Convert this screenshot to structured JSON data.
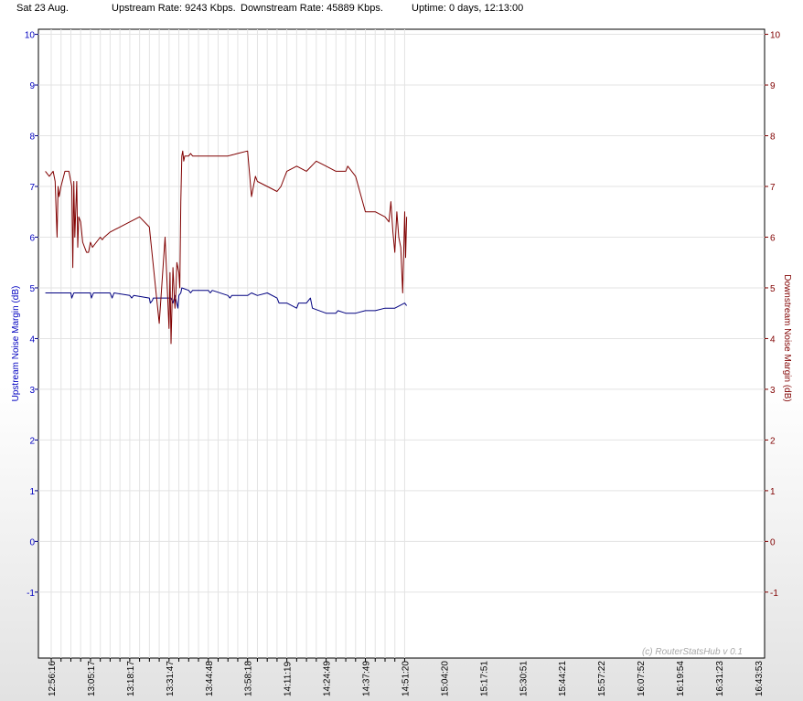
{
  "header": {
    "date": "Sat 23 Aug.",
    "upstream_rate": "Upstream Rate: 9243 Kbps.",
    "downstream_rate": "Downstream Rate: 45889 Kbps.",
    "uptime": "Uptime: 0 days, 12:13:00"
  },
  "watermark": "(c) RouterStatsHub v 0.1",
  "colors": {
    "upstream": "#000080",
    "downstream": "#800000",
    "left_axis": "#0000c0",
    "right_axis": "#800000"
  },
  "chart_data": {
    "type": "line",
    "ylabel_left": "Upstream Noise Margin (dB)",
    "ylabel_right": "Downstream Noise Margin (dB)",
    "ylim": [
      -2.3,
      10.1
    ],
    "yticks": [
      10,
      9,
      8,
      7,
      6,
      5,
      4,
      3,
      2,
      1,
      0,
      -1
    ],
    "x_tick_labels": [
      "12:56:16",
      "13:05:17",
      "13:18:17",
      "13:31:47",
      "13:44:48",
      "13:58:18",
      "14:11:19",
      "14:24:49",
      "14:37:49",
      "14:51:20",
      "15:04:20",
      "15:17:51",
      "15:30:51",
      "15:44:21",
      "15:57:22",
      "16:07:52",
      "16:19:54",
      "16:31:23",
      "16:43:53"
    ],
    "x_tick_pos": [
      0,
      0.5,
      1,
      1.5,
      2,
      2.5,
      3,
      3.5,
      4,
      4.5,
      5,
      5.5,
      6,
      6.5,
      7,
      7.5,
      8,
      8.5,
      9,
      9.5,
      10,
      10.5,
      11,
      11.5,
      12,
      12.5,
      13,
      13.5,
      14,
      14.5,
      15,
      15.5,
      16,
      16.5,
      17,
      17.5,
      18
    ],
    "grid": true,
    "series": [
      {
        "name": "Upstream Noise Margin (dB)",
        "axis": "left",
        "x": [
          -0.3,
          1,
          1.05,
          1.15,
          1.2,
          2,
          2.05,
          2.15,
          2.2,
          3,
          3.1,
          3.2,
          4,
          4.1,
          4.2,
          5,
          5.05,
          5.15,
          5.2,
          6.1,
          6.2,
          6.3,
          6.45,
          6.5,
          6.6,
          6.65,
          7,
          7.1,
          7.2,
          8,
          8.1,
          8.2,
          9,
          9.1,
          9.2,
          10,
          10.2,
          10.5,
          11,
          11.5,
          11.6,
          12,
          12.5,
          12.6,
          13,
          13.2,
          13.3,
          14,
          14.5,
          14.6,
          15,
          15.5,
          16,
          16.5,
          17,
          17.5,
          18,
          18.1
        ],
        "y": [
          4.9,
          4.9,
          4.8,
          4.9,
          4.9,
          4.9,
          4.8,
          4.9,
          4.9,
          4.9,
          4.8,
          4.9,
          4.85,
          4.8,
          4.85,
          4.8,
          4.7,
          4.75,
          4.8,
          4.8,
          4.7,
          4.85,
          4.6,
          4.85,
          4.9,
          5.0,
          4.95,
          4.9,
          4.95,
          4.95,
          4.9,
          4.95,
          4.85,
          4.8,
          4.85,
          4.85,
          4.9,
          4.85,
          4.9,
          4.8,
          4.7,
          4.7,
          4.6,
          4.7,
          4.7,
          4.8,
          4.6,
          4.5,
          4.5,
          4.55,
          4.5,
          4.5,
          4.55,
          4.55,
          4.6,
          4.6,
          4.7,
          4.65
        ]
      },
      {
        "name": "Downstream Noise Margin (dB)",
        "axis": "right",
        "x": [
          -0.3,
          -0.1,
          0.1,
          0.2,
          0.25,
          0.3,
          0.35,
          0.4,
          0.5,
          0.7,
          0.9,
          1.05,
          1.1,
          1.15,
          1.2,
          1.3,
          1.35,
          1.4,
          1.5,
          1.6,
          1.7,
          1.8,
          1.9,
          2.0,
          2.1,
          2.3,
          2.5,
          2.6,
          2.7,
          3.0,
          3.5,
          4.0,
          4.5,
          5.0,
          5.5,
          5.8,
          6.0,
          6.05,
          6.1,
          6.15,
          6.2,
          6.25,
          6.3,
          6.35,
          6.4,
          6.5,
          6.55,
          6.6,
          6.65,
          6.7,
          6.75,
          6.8,
          6.9,
          7.0,
          7.1,
          7.2,
          8.0,
          9.0,
          9.5,
          10.0,
          10.2,
          10.3,
          10.4,
          10.5,
          11.0,
          11.5,
          11.7,
          12.0,
          12.5,
          13.0,
          13.5,
          14.0,
          14.5,
          15.0,
          15.1,
          15.5,
          16.0,
          16.5,
          17.0,
          17.2,
          17.3,
          17.4,
          17.5,
          17.6,
          17.7,
          17.8,
          17.9,
          18.0,
          18.05,
          18.1
        ],
        "y": [
          7.3,
          7.2,
          7.3,
          7.1,
          6.5,
          6.0,
          7.0,
          6.8,
          7.0,
          7.3,
          7.3,
          7.0,
          5.4,
          7.1,
          6.0,
          7.1,
          5.8,
          6.4,
          6.3,
          5.9,
          5.8,
          5.7,
          5.7,
          5.9,
          5.8,
          5.9,
          6.0,
          5.95,
          6.0,
          6.1,
          6.2,
          6.3,
          6.4,
          6.2,
          4.3,
          6.0,
          4.2,
          5.3,
          3.9,
          4.6,
          5.4,
          5.0,
          4.6,
          4.9,
          5.5,
          5.3,
          5.0,
          6.7,
          7.6,
          7.7,
          7.5,
          7.6,
          7.6,
          7.6,
          7.65,
          7.6,
          7.6,
          7.6,
          7.65,
          7.7,
          6.8,
          7.0,
          7.2,
          7.1,
          7.0,
          6.9,
          7.0,
          7.3,
          7.4,
          7.3,
          7.5,
          7.4,
          7.3,
          7.3,
          7.4,
          7.2,
          6.5,
          6.5,
          6.4,
          6.3,
          6.7,
          6.1,
          5.7,
          6.5,
          6.0,
          5.8,
          4.9,
          6.5,
          5.6,
          6.4
        ]
      }
    ]
  }
}
